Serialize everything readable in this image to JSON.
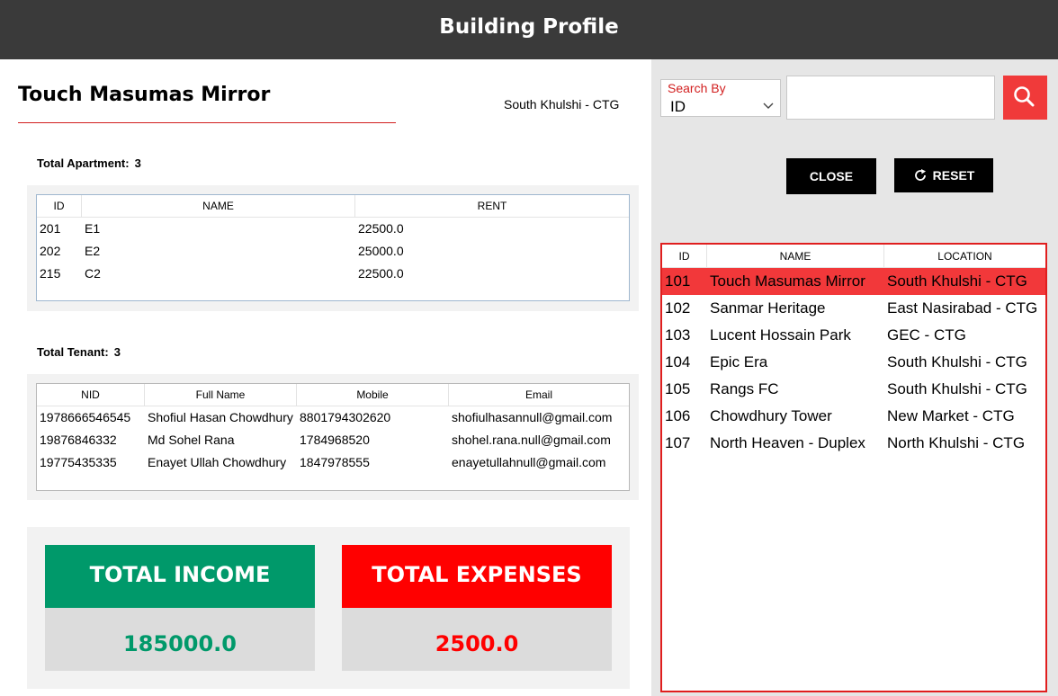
{
  "window": {
    "title": "Building Profile"
  },
  "building": {
    "name": "Touch Masumas Mirror",
    "location": "South Khulshi - CTG"
  },
  "apartments": {
    "caption": "Total Apartment:",
    "count": "3",
    "columns": [
      "ID",
      "NAME",
      "RENT"
    ],
    "rows": [
      [
        "201",
        "E1",
        "22500.0"
      ],
      [
        "202",
        "E2",
        "25000.0"
      ],
      [
        "215",
        "C2",
        "22500.0"
      ]
    ]
  },
  "tenants": {
    "caption": "Total Tenant:",
    "count": "3",
    "columns": [
      "NID",
      "Full Name",
      "Mobile",
      "Email"
    ],
    "rows": [
      [
        "1978666546545",
        "Shofiul Hasan Chowdhury",
        "8801794302620",
        "shofiulhasannull@gmail.com"
      ],
      [
        "19876846332",
        "Md Sohel Rana",
        "1784968520",
        "shohel.rana.null@gmail.com"
      ],
      [
        "19775435335",
        "Enayet Ullah Chowdhury",
        "1847978555",
        "enayetullahnull@gmail.com"
      ]
    ]
  },
  "summary": {
    "income_label": "TOTAL INCOME",
    "income_value": "185000.0",
    "expenses_label": "TOTAL EXPENSES",
    "expenses_value": "2500.0",
    "income_color": "#00996a",
    "expenses_color": "#ff0000"
  },
  "search": {
    "label": "Search By",
    "selected": "ID",
    "query": "",
    "button_icon": "search-icon"
  },
  "buttons": {
    "close": "CLOSE",
    "reset": "RESET",
    "reset_icon": "refresh-icon"
  },
  "buildings": {
    "columns": [
      "ID",
      "NAME",
      "LOCATION"
    ],
    "selected_index": 0,
    "rows": [
      [
        "101",
        "Touch Masumas Mirror",
        "South Khulshi - CTG"
      ],
      [
        "102",
        "Sanmar Heritage",
        "East Nasirabad - CTG"
      ],
      [
        "103",
        "Lucent Hossain Park",
        "GEC - CTG"
      ],
      [
        "104",
        "Epic Era",
        "South Khulshi - CTG"
      ],
      [
        "105",
        "Rangs FC",
        "South Khulshi - CTG"
      ],
      [
        "106",
        "Chowdhury Tower",
        "New Market - CTG"
      ],
      [
        "107",
        "North Heaven - Duplex",
        "North Khulshi - CTG"
      ]
    ]
  },
  "colors": {
    "titlebar": "#3a3a3a",
    "accent_red": "#e01e1e",
    "selection": "#f2383a"
  }
}
